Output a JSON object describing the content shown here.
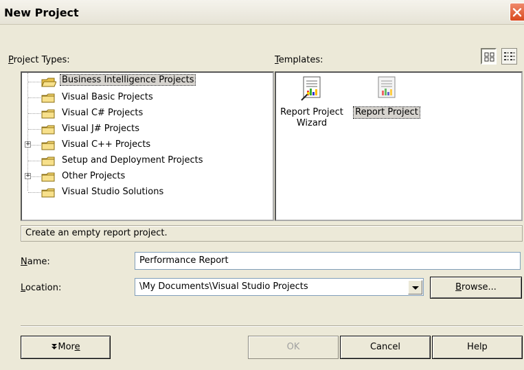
{
  "window": {
    "title": "New Project"
  },
  "labels": {
    "project_types": "Project Types:",
    "project_types_key": "P",
    "project_types_rest": "roject Types:",
    "templates_key": "T",
    "templates_rest": "emplates:",
    "name_key": "N",
    "name_rest": "ame:",
    "location_key": "L",
    "location_rest": "ocation:"
  },
  "project_types": [
    {
      "label": "Business Intelligence Projects",
      "selected": true,
      "open": true,
      "expandable": false
    },
    {
      "label": "Visual Basic Projects",
      "selected": false,
      "expandable": false
    },
    {
      "label": "Visual C# Projects",
      "selected": false,
      "expandable": false
    },
    {
      "label": "Visual J# Projects",
      "selected": false,
      "expandable": false
    },
    {
      "label": "Visual C++ Projects",
      "selected": false,
      "expandable": true
    },
    {
      "label": "Setup and Deployment Projects",
      "selected": false,
      "expandable": false
    },
    {
      "label": "Other Projects",
      "selected": false,
      "expandable": true
    },
    {
      "label": "Visual Studio Solutions",
      "selected": false,
      "expandable": false
    }
  ],
  "templates": [
    {
      "line1": "Report Project",
      "line2": "Wizard",
      "selected": false,
      "icon": "report-wizard-icon"
    },
    {
      "line1": "Report Project",
      "line2": "",
      "selected": true,
      "icon": "report-project-icon"
    }
  ],
  "status_text": "Create an empty report project.",
  "name_value": "Performance Report",
  "location_value": "\\My Documents\\Visual Studio Projects",
  "buttons": {
    "browse_key": "B",
    "browse_rest": "rowse...",
    "more_prefix": "Mor",
    "more_key": "e",
    "ok": "OK",
    "cancel": "Cancel",
    "help": "Help"
  },
  "colors": {
    "close_button": "#d9491d",
    "folder": "#f3d56e",
    "selection": "#d6d3ce"
  }
}
